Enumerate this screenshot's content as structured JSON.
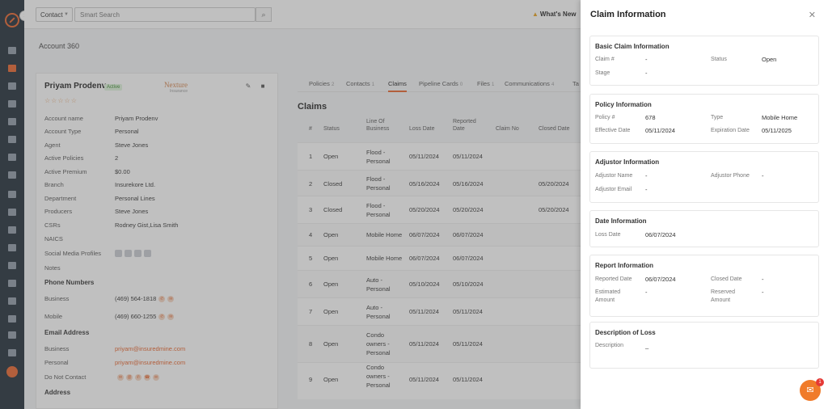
{
  "topbar": {
    "search_type": "Contact",
    "search_placeholder": "Smart Search",
    "whats_new": "What's New"
  },
  "breadcrumb": "Account 360",
  "account": {
    "name": "Priyam Prodenv",
    "badge": "Active",
    "brand": "Nexture",
    "brand_sub": "Insurance",
    "fields": [
      {
        "k": "Account name",
        "v": "Priyam Prodenv"
      },
      {
        "k": "Account Type",
        "v": "Personal"
      },
      {
        "k": "Agent",
        "v": "Steve Jones"
      },
      {
        "k": "Active Policies",
        "v": "2"
      },
      {
        "k": "Active Premium",
        "v": "$0.00"
      },
      {
        "k": "Branch",
        "v": "Insurekore Ltd."
      },
      {
        "k": "Department",
        "v": "Personal Lines"
      },
      {
        "k": "Producers",
        "v": "Steve Jones"
      },
      {
        "k": "CSRs",
        "v": "Rodney Gist,Lisa Smith"
      },
      {
        "k": "NAICS",
        "v": ""
      }
    ],
    "social_label": "Social Media Profiles",
    "notes_label": "Notes",
    "phone_heading": "Phone Numbers",
    "phones": [
      {
        "k": "Business",
        "v": "(469) 564-1818"
      },
      {
        "k": "Mobile",
        "v": "(469) 660-1255"
      }
    ],
    "email_heading": "Email Address",
    "emails": [
      {
        "k": "Business",
        "v": "priyam@insuredmine.com"
      },
      {
        "k": "Personal",
        "v": "priyam@insuredmine.com"
      }
    ],
    "dnc_label": "Do Not Contact",
    "address_heading": "Address"
  },
  "tabs": [
    {
      "label": "Policies",
      "count": "2"
    },
    {
      "label": "Contacts",
      "count": "1"
    },
    {
      "label": "Claims",
      "count": ""
    },
    {
      "label": "Pipeline Cards",
      "count": "0"
    },
    {
      "label": "Files",
      "count": "1"
    },
    {
      "label": "Communications",
      "count": "4"
    },
    {
      "label": "Ta",
      "count": ""
    }
  ],
  "claims": {
    "title": "Claims",
    "columns": [
      "#",
      "Status",
      "Line Of Business",
      "Loss Date",
      "Reported Date",
      "Claim No",
      "Closed Date"
    ],
    "rows": [
      {
        "n": "1",
        "status": "Open",
        "lob": "Flood - Personal",
        "loss": "05/11/2024",
        "rep": "05/11/2024",
        "no": "",
        "closed": ""
      },
      {
        "n": "2",
        "status": "Closed",
        "lob": "Flood - Personal",
        "loss": "05/16/2024",
        "rep": "05/16/2024",
        "no": "",
        "closed": "05/20/2024"
      },
      {
        "n": "3",
        "status": "Closed",
        "lob": "Flood - Personal",
        "loss": "05/20/2024",
        "rep": "05/20/2024",
        "no": "",
        "closed": "05/20/2024"
      },
      {
        "n": "4",
        "status": "Open",
        "lob": "Mobile Home",
        "loss": "06/07/2024",
        "rep": "06/07/2024",
        "no": "",
        "closed": ""
      },
      {
        "n": "5",
        "status": "Open",
        "lob": "Mobile Home",
        "loss": "06/07/2024",
        "rep": "06/07/2024",
        "no": "",
        "closed": ""
      },
      {
        "n": "6",
        "status": "Open",
        "lob": "Auto - Personal",
        "loss": "05/10/2024",
        "rep": "05/10/2024",
        "no": "",
        "closed": ""
      },
      {
        "n": "7",
        "status": "Open",
        "lob": "Auto - Personal",
        "loss": "05/11/2024",
        "rep": "05/11/2024",
        "no": "",
        "closed": ""
      },
      {
        "n": "8",
        "status": "Open",
        "lob": "Condo owners - Personal",
        "loss": "05/11/2024",
        "rep": "05/11/2024",
        "no": "",
        "closed": ""
      },
      {
        "n": "9",
        "status": "Open",
        "lob": "Condo owners - Personal",
        "loss": "05/11/2024",
        "rep": "05/11/2024",
        "no": "",
        "closed": ""
      }
    ]
  },
  "panel": {
    "title": "Claim Information",
    "basic": {
      "heading": "Basic Claim Information",
      "claim_label": "Claim #",
      "claim_value": "-",
      "status_label": "Status",
      "status_value": "Open",
      "stage_label": "Stage",
      "stage_value": "-"
    },
    "policy": {
      "heading": "Policy Information",
      "policy_label": "Policy #",
      "policy_value": "678",
      "type_label": "Type",
      "type_value": "Mobile Home",
      "eff_label": "Effective Date",
      "eff_value": "05/11/2024",
      "exp_label": "Expiration Date",
      "exp_value": "05/11/2025"
    },
    "adjustor": {
      "heading": "Adjustor Information",
      "name_label": "Adjustor Name",
      "name_value": "-",
      "phone_label": "Adjustor Phone",
      "phone_value": "-",
      "email_label": "Adjustor Email",
      "email_value": "-"
    },
    "date": {
      "heading": "Date Information",
      "loss_label": "Loss Date",
      "loss_value": "06/07/2024"
    },
    "report": {
      "heading": "Report Information",
      "rep_label": "Reported Date",
      "rep_value": "06/07/2024",
      "closed_label": "Closed Date",
      "closed_value": "-",
      "est_label": "Estimated Amount",
      "est_value": "-",
      "res_label": "Reserved Amount",
      "res_value": "-"
    },
    "desc": {
      "heading": "Description of Loss",
      "desc_label": "Description",
      "desc_value": "_"
    }
  },
  "chat": {
    "badge": "1"
  },
  "colors": {
    "accent": "#e8632b",
    "rail": "#1e2a36"
  }
}
